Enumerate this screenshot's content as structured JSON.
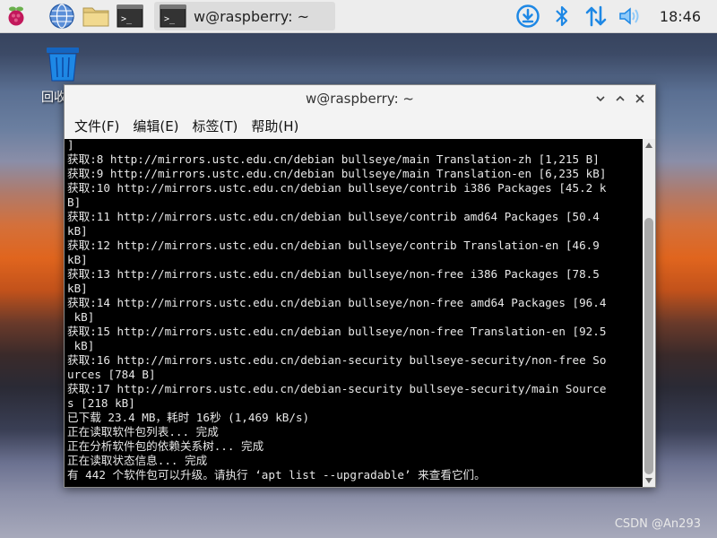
{
  "panel": {
    "icons": [
      "raspberry-menu-icon",
      "web-browser-icon",
      "file-manager-icon",
      "terminal-icon"
    ],
    "task": {
      "label": "w@raspberry: ~"
    },
    "tray": [
      "download-icon",
      "bluetooth-icon",
      "network-icon",
      "volume-icon"
    ],
    "clock": "18:46"
  },
  "desktop": {
    "trash_label": "回收站"
  },
  "window": {
    "title": "w@raspberry: ~",
    "menu": [
      "文件(F)",
      "编辑(E)",
      "标签(T)",
      "帮助(H)"
    ]
  },
  "terminal": {
    "lines": [
      "]",
      "获取:8 http://mirrors.ustc.edu.cn/debian bullseye/main Translation-zh [1,215 B]",
      "获取:9 http://mirrors.ustc.edu.cn/debian bullseye/main Translation-en [6,235 kB]",
      "获取:10 http://mirrors.ustc.edu.cn/debian bullseye/contrib i386 Packages [45.2 k",
      "B]",
      "获取:11 http://mirrors.ustc.edu.cn/debian bullseye/contrib amd64 Packages [50.4",
      "kB]",
      "获取:12 http://mirrors.ustc.edu.cn/debian bullseye/contrib Translation-en [46.9",
      "kB]",
      "获取:13 http://mirrors.ustc.edu.cn/debian bullseye/non-free i386 Packages [78.5",
      "kB]",
      "获取:14 http://mirrors.ustc.edu.cn/debian bullseye/non-free amd64 Packages [96.4",
      " kB]",
      "获取:15 http://mirrors.ustc.edu.cn/debian bullseye/non-free Translation-en [92.5",
      " kB]",
      "获取:16 http://mirrors.ustc.edu.cn/debian-security bullseye-security/non-free So",
      "urces [784 B]",
      "获取:17 http://mirrors.ustc.edu.cn/debian-security bullseye-security/main Source",
      "s [218 kB]",
      "已下载 23.4 MB，耗时 16秒 (1,469 kB/s)",
      "正在读取软件包列表... 完成",
      "正在分析软件包的依赖关系树... 完成",
      "正在读取状态信息... 完成",
      "有 442 个软件包可以升级。请执行 ‘apt list --upgradable’ 来查看它们。"
    ]
  },
  "watermark": "CSDN @An293"
}
